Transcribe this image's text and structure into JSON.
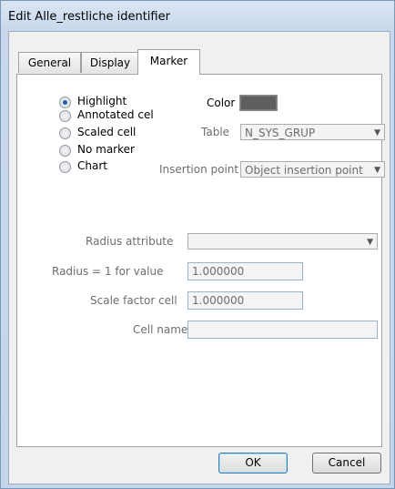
{
  "window": {
    "title": "Edit Alle_restliche identifier"
  },
  "tabs": [
    {
      "label": "General"
    },
    {
      "label": "Display"
    },
    {
      "label": "Marker"
    }
  ],
  "marker": {
    "options": [
      {
        "label": "Highlight",
        "checked": true
      },
      {
        "label": "Annotated cel",
        "checked": false
      },
      {
        "label": "Scaled cell",
        "checked": false
      },
      {
        "label": "No marker",
        "checked": false
      },
      {
        "label": "Chart",
        "checked": false
      }
    ],
    "color_label": "Color",
    "color_value": "#5f5f5f",
    "table_label": "Table",
    "table_value": "N_SYS_GRUP",
    "insertion_label": "Insertion point",
    "insertion_value": "Object insertion point",
    "radius_attr_label": "Radius attribute",
    "radius_attr_value": "",
    "radius_value_label": "Radius = 1 for value",
    "radius_value": "1.000000",
    "scale_factor_label": "Scale factor cell",
    "scale_factor_value": "1.000000",
    "cell_name_label": "Cell name",
    "cell_name_value": ""
  },
  "buttons": {
    "ok": "OK",
    "cancel": "Cancel"
  }
}
